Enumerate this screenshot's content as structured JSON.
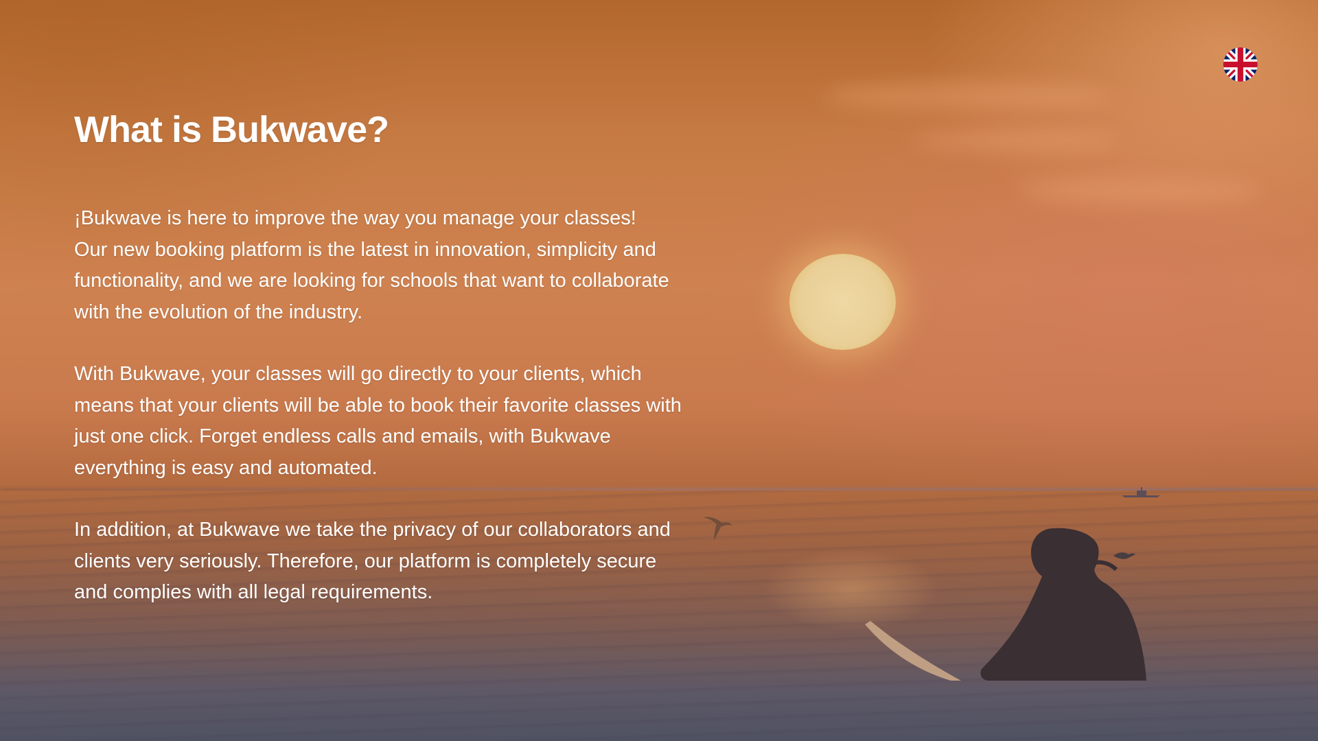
{
  "language": {
    "current_icon": "uk-flag-icon"
  },
  "hero": {
    "title": "What is Bukwave?",
    "paragraphs": [
      {
        "lines": [
          "¡Bukwave is here to improve the way you manage your classes!",
          "Our new booking platform is the latest in innovation, simplicity and",
          "functionality, and we are looking for schools that want to collaborate",
          "with the evolution of the industry."
        ]
      },
      {
        "lines": [
          "With Bukwave, your classes will go directly to your clients, which",
          "means that your clients will be able to book their favorite classes with",
          "just one click. Forget endless calls and emails, with Bukwave",
          "everything is easy and automated."
        ]
      },
      {
        "lines": [
          "In addition, at Bukwave we take the privacy of our collaborators and",
          "clients very seriously. Therefore, our platform is completely secure",
          "and complies with all legal requirements."
        ]
      }
    ]
  },
  "background": {
    "scene": "sunset-surfer-photo",
    "colors": {
      "sky_top": "#b2672c",
      "sun": "#efd8a4",
      "sea": "#7d5b52",
      "text": "#ffffff"
    }
  }
}
